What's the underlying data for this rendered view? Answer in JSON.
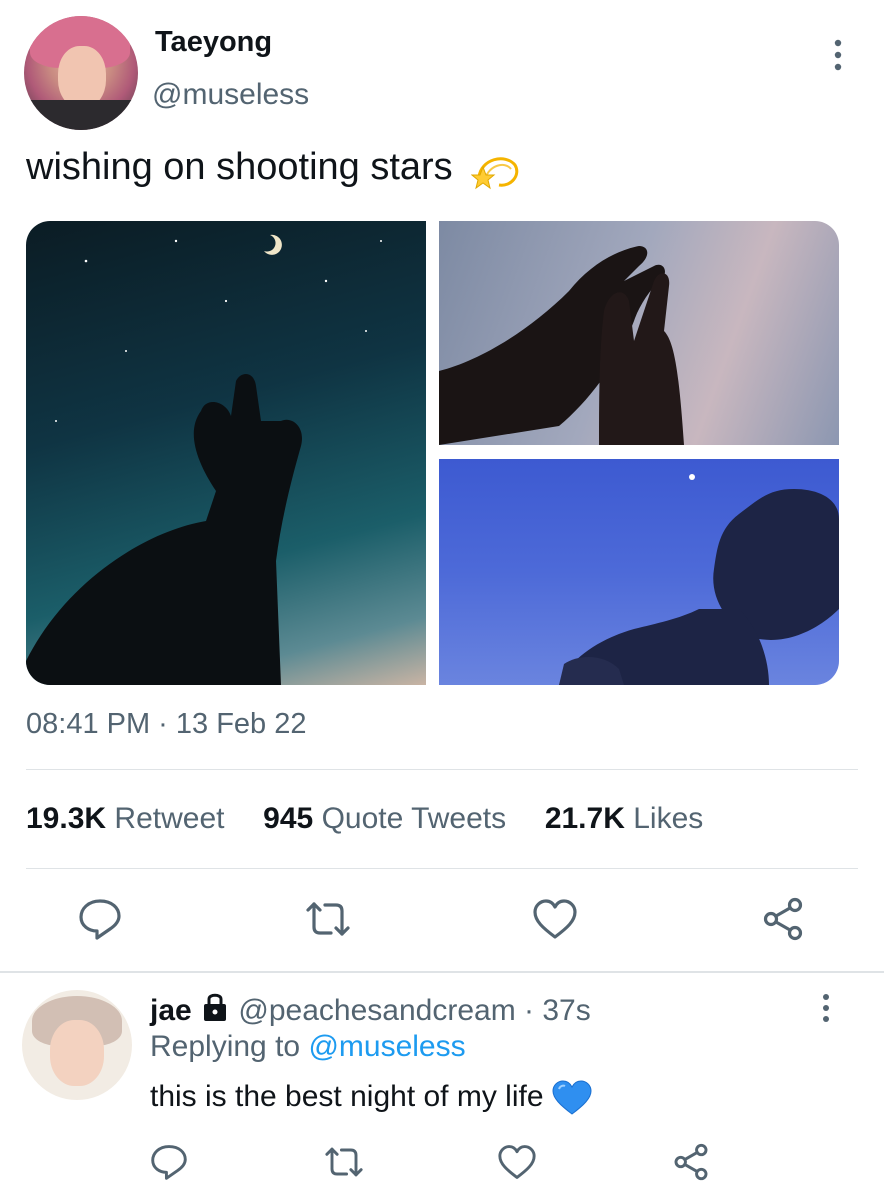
{
  "tweet": {
    "author_name": "Taeyong",
    "author_handle": "@museless",
    "text": "wishing on shooting stars",
    "timestamp": "08:41 PM · 13 Feb 22",
    "stats": {
      "retweets_count": "19.3K",
      "retweets_label": "Retweet",
      "quotes_count": "945",
      "quotes_label": "Quote Tweets",
      "likes_count": "21.7K",
      "likes_label": "Likes"
    },
    "icons": {
      "more": "more-vertical-icon",
      "emoji": "dizzy-star-emoji",
      "actions": [
        "reply-icon",
        "retweet-icon",
        "like-icon",
        "share-icon"
      ]
    }
  },
  "reply": {
    "author_name": "jae",
    "lock_icon": "lock-icon",
    "author_handle": "@peachesandcream",
    "time": "· 37s",
    "replying_prefix": "Replying to",
    "replying_to": "@museless",
    "text": "this is the best night of my life",
    "emoji": "blue-heart-emoji"
  },
  "colors": {
    "text_primary": "#0f1419",
    "text_secondary": "#536471",
    "accent": "#1d9bf0",
    "divider": "#dfe3e6"
  }
}
